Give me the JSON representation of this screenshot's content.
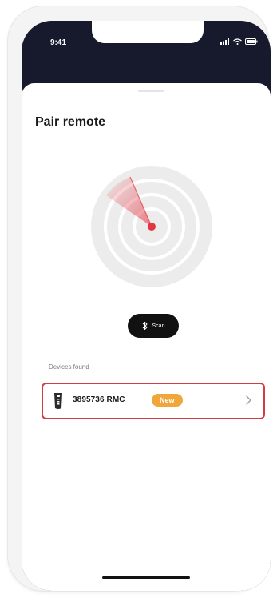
{
  "status_bar": {
    "time": "9:41",
    "icons": [
      "signal-icon",
      "wifi-icon",
      "battery-icon"
    ]
  },
  "sheet": {
    "title": "Pair remote"
  },
  "radar": {
    "colors": {
      "rings": "#e9e9e9",
      "sweep": "#e5454f",
      "dot": "#e33642"
    }
  },
  "scan": {
    "label": "Scan",
    "icon": "bluetooth-icon"
  },
  "devices": {
    "section_label": "Devices found",
    "items": [
      {
        "name": "3895736 RMC",
        "badge": "New",
        "icon": "remote-icon",
        "chevron": "chevron-right-icon"
      }
    ]
  },
  "colors": {
    "accent": "#d33b47",
    "badge": "#f1a63a",
    "header_dark": "#161a2c"
  }
}
